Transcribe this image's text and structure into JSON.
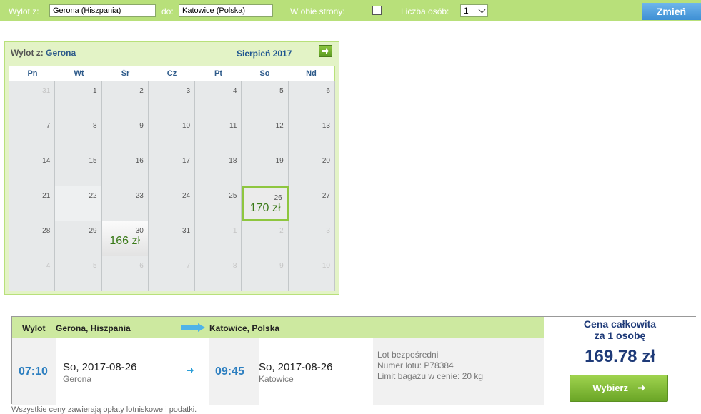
{
  "search": {
    "from_label": "Wylot z:",
    "from_value": "Gerona (Hiszpania)",
    "to_label": "do:",
    "to_value": "Katowice (Polska)",
    "roundtrip_label": "W obie strony:",
    "roundtrip_checked": false,
    "persons_label": "Liczba osób:",
    "persons_value": "1",
    "change_button": "Zmień"
  },
  "calendar": {
    "from_label": "Wylot z:",
    "from_city": "Gerona",
    "month": "Sierpień 2017",
    "next_icon": "arrow-right-icon",
    "weekdays": [
      "Pn",
      "Wt",
      "Śr",
      "Cz",
      "Pt",
      "So",
      "Nd"
    ],
    "weeks": [
      [
        {
          "d": "31",
          "other": true
        },
        {
          "d": "1"
        },
        {
          "d": "2"
        },
        {
          "d": "3"
        },
        {
          "d": "4"
        },
        {
          "d": "5"
        },
        {
          "d": "6"
        }
      ],
      [
        {
          "d": "7"
        },
        {
          "d": "8"
        },
        {
          "d": "9"
        },
        {
          "d": "10"
        },
        {
          "d": "11"
        },
        {
          "d": "12"
        },
        {
          "d": "13"
        }
      ],
      [
        {
          "d": "14"
        },
        {
          "d": "15"
        },
        {
          "d": "16"
        },
        {
          "d": "17"
        },
        {
          "d": "18"
        },
        {
          "d": "19"
        },
        {
          "d": "20"
        }
      ],
      [
        {
          "d": "21"
        },
        {
          "d": "22",
          "today": true
        },
        {
          "d": "23"
        },
        {
          "d": "24"
        },
        {
          "d": "25"
        },
        {
          "d": "26",
          "price": "170 zł",
          "selected": true
        },
        {
          "d": "27"
        }
      ],
      [
        {
          "d": "28"
        },
        {
          "d": "29"
        },
        {
          "d": "30",
          "price": "166 zł"
        },
        {
          "d": "31"
        },
        {
          "d": "1",
          "other": true
        },
        {
          "d": "2",
          "other": true
        },
        {
          "d": "3",
          "other": true
        }
      ],
      [
        {
          "d": "4",
          "other": true
        },
        {
          "d": "5",
          "other": true
        },
        {
          "d": "6",
          "other": true
        },
        {
          "d": "7",
          "other": true
        },
        {
          "d": "8",
          "other": true
        },
        {
          "d": "9",
          "other": true
        },
        {
          "d": "10",
          "other": true
        }
      ]
    ]
  },
  "flight": {
    "header_label": "Wylot",
    "from_place": "Gerona, Hiszpania",
    "to_place": "Katowice, Polska",
    "dep_time": "07:10",
    "dep_date": "So, 2017-08-26",
    "dep_city": "Gerona",
    "arr_time": "09:45",
    "arr_date": "So, 2017-08-26",
    "arr_city": "Katowice",
    "info": [
      "Lot bezpośredni",
      "Numer lotu: P78384",
      "Limit bagażu w cenie: 20 kg"
    ],
    "price_title_1": "Cena całkowita",
    "price_title_2": "za 1 osobę",
    "price_total": "169.78 zł",
    "select_button": "Wybierz",
    "select_icon": "arrow-right-icon"
  },
  "footer_partial": "Wszystkie ceny zawierają opłaty lotniskowe i podatki."
}
